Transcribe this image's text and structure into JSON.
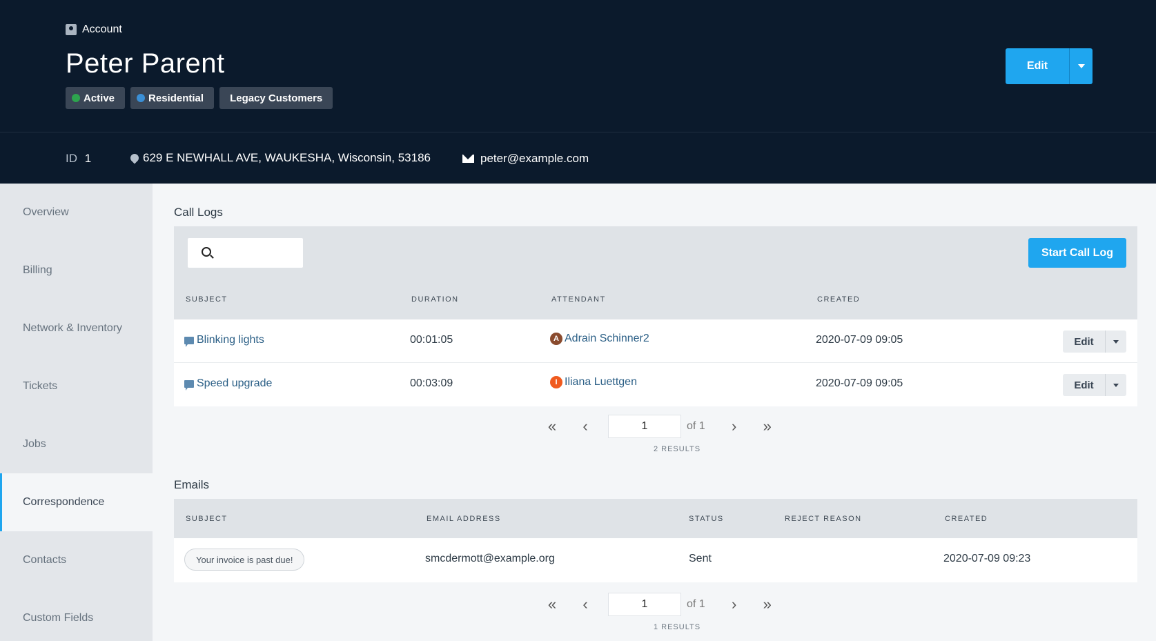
{
  "header": {
    "breadcrumb": "Account",
    "title": "Peter Parent",
    "badges": [
      {
        "label": "Active",
        "dot_color": "#2da44e"
      },
      {
        "label": "Residential",
        "dot_color": "#3a8fd6"
      },
      {
        "label": "Legacy Customers"
      }
    ],
    "edit_label": "Edit"
  },
  "subheader": {
    "id_label": "ID",
    "id_value": "1",
    "address": "629 E NEWHALL AVE, WAUKESHA, Wisconsin, 53186",
    "email": "peter@example.com"
  },
  "sidebar": {
    "items": [
      {
        "label": "Overview"
      },
      {
        "label": "Billing"
      },
      {
        "label": "Network & Inventory"
      },
      {
        "label": "Tickets"
      },
      {
        "label": "Jobs"
      },
      {
        "label": "Correspondence",
        "active": true
      },
      {
        "label": "Contacts"
      },
      {
        "label": "Custom Fields"
      }
    ]
  },
  "call_logs": {
    "title": "Call Logs",
    "search_value": "",
    "start_button": "Start Call Log",
    "columns": [
      "SUBJECT",
      "DURATION",
      "ATTENDANT",
      "CREATED"
    ],
    "rows": [
      {
        "subject": "Blinking lights",
        "duration": "00:01:05",
        "attendant": "Adrain Schinner2",
        "avatar_letter": "A",
        "avatar_color": "#8a4b2e",
        "created": "2020-07-09 09:05",
        "edit": "Edit"
      },
      {
        "subject": "Speed upgrade",
        "duration": "00:03:09",
        "attendant": "Iliana Luettgen",
        "avatar_letter": "I",
        "avatar_color": "#f05a1e",
        "created": "2020-07-09 09:05",
        "edit": "Edit"
      }
    ],
    "pager": {
      "page": "1",
      "of": "of 1",
      "results": "2 RESULTS"
    }
  },
  "emails": {
    "title": "Emails",
    "columns": [
      "SUBJECT",
      "EMAIL ADDRESS",
      "STATUS",
      "REJECT REASON",
      "CREATED"
    ],
    "rows": [
      {
        "subject": "Your invoice is past due!",
        "email": "smcdermott@example.org",
        "status": "Sent",
        "reject_reason": "",
        "created": "2020-07-09 09:23"
      }
    ],
    "pager": {
      "page": "1",
      "of": "of 1",
      "results": "1 RESULTS"
    }
  }
}
